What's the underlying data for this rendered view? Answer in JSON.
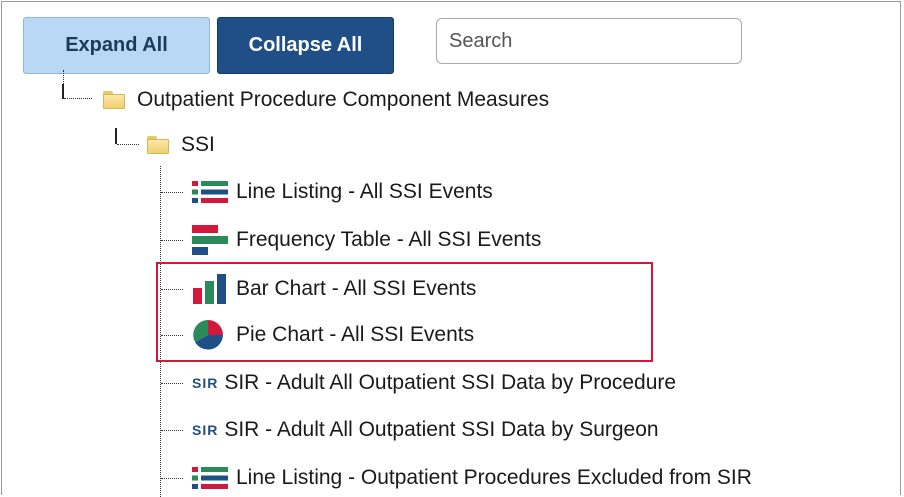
{
  "toolbar": {
    "expand_label": "Expand All",
    "collapse_label": "Collapse All",
    "search_placeholder": "Search"
  },
  "tree": {
    "root": {
      "label": "Outpatient Procedure Component Measures",
      "icon": "folder-icon"
    },
    "folder": {
      "label": "SSI",
      "icon": "folder-icon"
    },
    "items": [
      {
        "label": "Line Listing - All SSI Events",
        "icon": "line-listing-icon"
      },
      {
        "label": "Frequency Table - All SSI Events",
        "icon": "frequency-table-icon"
      },
      {
        "label": "Bar Chart - All SSI Events",
        "icon": "bar-chart-icon"
      },
      {
        "label": "Pie Chart - All SSI Events",
        "icon": "pie-chart-icon"
      },
      {
        "label": "SIR - Adult All Outpatient SSI Data by Procedure",
        "icon": "sir-icon",
        "icon_text": "SIR"
      },
      {
        "label": "SIR - Adult All Outpatient SSI Data by Surgeon",
        "icon": "sir-icon",
        "icon_text": "SIR"
      },
      {
        "label": "Line Listing - Outpatient Procedures Excluded from SIR",
        "icon": "line-listing-icon"
      }
    ]
  },
  "colors": {
    "highlight_border": "#d4183c",
    "collapse_button": "#1f4f86",
    "expand_button": "#b8d8f5"
  }
}
